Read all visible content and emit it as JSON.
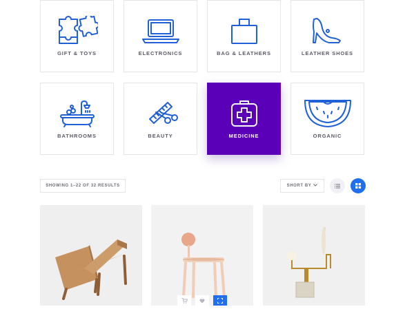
{
  "categories": [
    {
      "label": "GIFT & TOYS",
      "icon": "puzzle-icon",
      "active": false
    },
    {
      "label": "ELECTRONICS",
      "icon": "laptop-icon",
      "active": false
    },
    {
      "label": "BAG & LEATHERS",
      "icon": "bag-icon",
      "active": false
    },
    {
      "label": "LEATHER SHOES",
      "icon": "high-heel-shoe-icon",
      "active": false
    },
    {
      "label": "BATHROOMS",
      "icon": "bathtub-icon",
      "active": false
    },
    {
      "label": "BEAUTY",
      "icon": "comb-scissors-icon",
      "active": false
    },
    {
      "label": "MEDICINE",
      "icon": "medical-kit-icon",
      "active": true
    },
    {
      "label": "ORGANIC",
      "icon": "watermelon-icon",
      "active": false
    }
  ],
  "toolbar": {
    "results_text": "SHOWING 1–22 OF 32 RESULTS",
    "sort_label": "SHORT BY",
    "sort_icon": "chevron-down-icon",
    "list_view_icon": "list-view-icon",
    "grid_view_icon": "grid-view-icon",
    "active_view": "grid"
  },
  "products": [
    {
      "image": "wooden-bookstand"
    },
    {
      "image": "pink-chair",
      "actions": [
        "cart-icon",
        "heart-icon",
        "expand-icon"
      ]
    },
    {
      "image": "table-lamp"
    }
  ],
  "colors": {
    "accent": "#5a00b8",
    "primary": "#1f6ff0",
    "icon": "#1f5fd8"
  }
}
